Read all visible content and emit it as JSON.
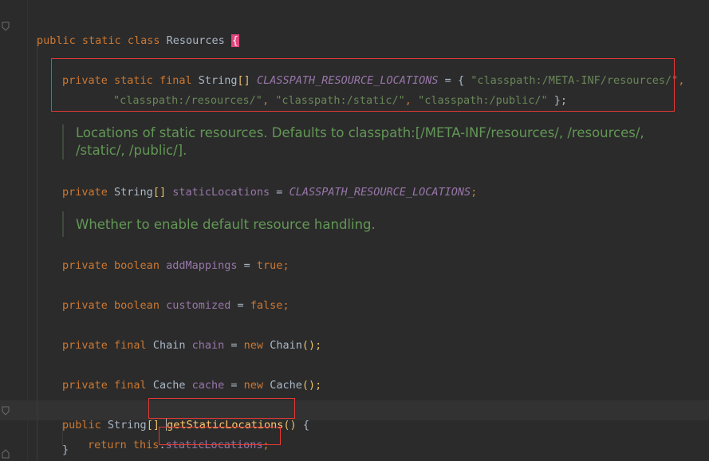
{
  "editor": {
    "lines": {
      "class_decl": {
        "kw1": "public",
        "kw2": "static",
        "kw3": "class",
        "name": "Resources",
        "brace": "{"
      },
      "const_decl": {
        "kw1": "private",
        "kw2": "static",
        "kw3": "final",
        "type": "String",
        "brackets": "[]",
        "name": "CLASSPATH_RESOURCE_LOCATIONS",
        "eq": "=",
        "open": "{",
        "s1": "\"classpath:/META-INF/resources/\"",
        "c1": ",",
        "s2": "\"classpath:/resources/\"",
        "c2": ",",
        "s3": "\"classpath:/static/\"",
        "c3": ",",
        "s4": "\"classpath:/public/\"",
        "close": "};"
      },
      "doc1": "Locations of static resources. Defaults to classpath:[/META-INF/resources/, /resources/, /static/, /public/].",
      "static_locations": {
        "kw": "private",
        "type": "String",
        "brackets": "[]",
        "name": "staticLocations",
        "eq": "=",
        "value": "CLASSPATH_RESOURCE_LOCATIONS",
        "semi": ";"
      },
      "doc2": "Whether to enable default resource handling.",
      "add_mappings": {
        "kw": "private",
        "type": "boolean",
        "name": "addMappings",
        "eq": "=",
        "value": "true",
        "semi": ";"
      },
      "customized": {
        "kw": "private",
        "type": "boolean",
        "name": "customized",
        "eq": "=",
        "value": "false",
        "semi": ";"
      },
      "chain": {
        "kw": "private",
        "kw2": "final",
        "type": "Chain",
        "name": "chain",
        "eq": "=",
        "new": "new",
        "ctor": "Chain",
        "rest": "();"
      },
      "cache": {
        "kw": "private",
        "kw2": "final",
        "type": "Cache",
        "name": "cache",
        "eq": "=",
        "new": "new",
        "ctor": "Cache",
        "rest": "();"
      },
      "getter": {
        "kw": "public",
        "type": "String",
        "brackets": "[]",
        "name": "getStaticLocations",
        "parens": "()",
        "brace": "{"
      },
      "return_line": {
        "kw": "return",
        "this": "this",
        "dot": ".",
        "field": "staticLocations",
        "semi": ";"
      },
      "close_brace": "}"
    }
  }
}
